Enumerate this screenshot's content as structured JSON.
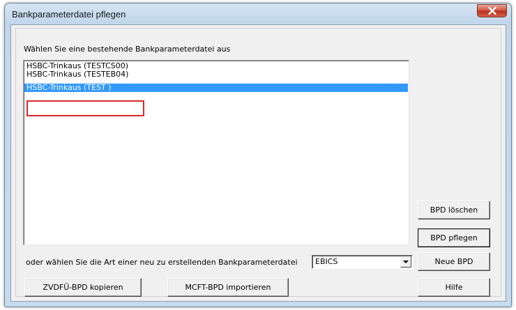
{
  "window": {
    "title": "Bankparameterdatei pflegen"
  },
  "dialog": {
    "select_prompt": "Wählen Sie eine bestehende Bankparameterdatei aus",
    "list_items": [
      {
        "label": "HSBC-Trinkaus (TESTCS00)",
        "selected": false
      },
      {
        "label": "HSBC-Trinkaus (TESTEB04)",
        "selected": false
      },
      {
        "label": "HSBC-Trinkaus (TEST           )",
        "selected": true
      }
    ],
    "new_prompt": "oder wählen Sie die Art einer neu zu erstellenden Bankparameterdatei",
    "type_select": {
      "value": "EBICS"
    }
  },
  "buttons": {
    "delete_bpd": "BPD löschen",
    "maintain_bpd": "BPD pflegen",
    "new_bpd": "Neue BPD",
    "help": "Hilfe",
    "copy_zvdfu": "ZVDFÜ-BPD kopieren",
    "import_mcft": "MCFT-BPD importieren"
  },
  "icons": {
    "close": "close-icon",
    "dropdown": "chevron-down-icon"
  },
  "colors": {
    "selection": "#3399ff",
    "highlight_box": "#d42a2a",
    "close_button": "#c9432c"
  }
}
